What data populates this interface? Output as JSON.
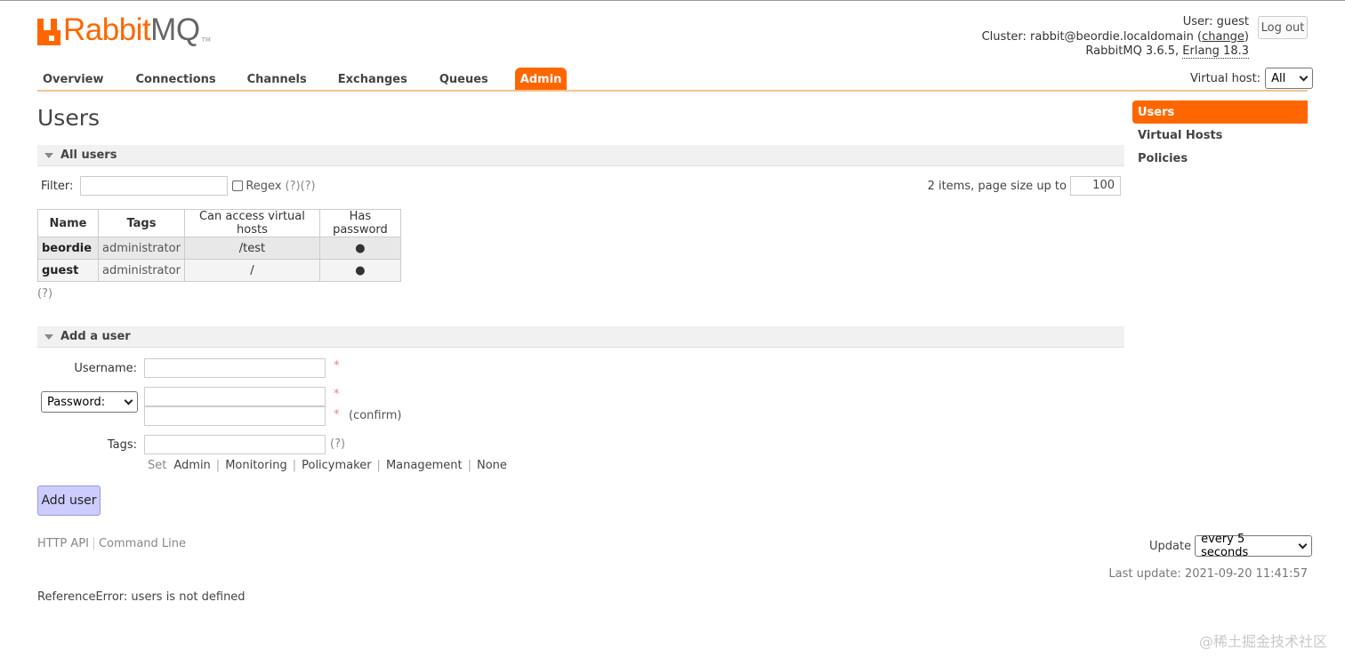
{
  "logo": {
    "brand_a": "Rabbit",
    "brand_b": "MQ",
    "tm": "TM"
  },
  "header": {
    "user_label": "User:",
    "user_value": "guest",
    "cluster_label": "Cluster:",
    "cluster_value": "rabbit@beordie.localdomain",
    "change_link": "change",
    "version": "RabbitMQ 3.6.5,",
    "erlang": "Erlang 18.3",
    "logout": "Log out"
  },
  "nav": {
    "tabs": [
      "Overview",
      "Connections",
      "Channels",
      "Exchanges",
      "Queues",
      "Admin"
    ],
    "active": "Admin",
    "vhost_label": "Virtual host:",
    "vhost_value": "All"
  },
  "page": {
    "title": "Users"
  },
  "sidebar": {
    "items": [
      "Users",
      "Virtual Hosts",
      "Policies"
    ]
  },
  "all_users": {
    "header": "All users",
    "filter_label": "Filter:",
    "regex_label": "Regex",
    "regex_help": "(?)(?)",
    "count_text": "2 items, page size up to",
    "page_size": "100",
    "columns": [
      "Name",
      "Tags",
      "Can access virtual hosts",
      "Has password"
    ],
    "rows": [
      {
        "name": "beordie",
        "tags": "administrator",
        "vhosts": "/test",
        "has_password": "●"
      },
      {
        "name": "guest",
        "tags": "administrator",
        "vhosts": "/",
        "has_password": "●"
      }
    ],
    "help": "(?)"
  },
  "add_user": {
    "header": "Add a user",
    "username_label": "Username:",
    "password_option": "Password:",
    "confirm_label": "(confirm)",
    "tags_label": "Tags:",
    "tags_help": "(?)",
    "required_mark": "*",
    "set_label": "Set",
    "tag_links": [
      "Admin",
      "Monitoring",
      "Policymaker",
      "Management",
      "None"
    ],
    "submit": "Add user"
  },
  "footer": {
    "links": [
      "HTTP API",
      "Command Line"
    ],
    "update_label": "Update",
    "update_value": "every 5 seconds",
    "last_update": "Last update: 2021-09-20 11:41:57",
    "error": "ReferenceError: users is not defined",
    "watermark": "@稀土掘金技术社区"
  },
  "colors": {
    "accent": "#ff6600",
    "button": "#ccccff"
  }
}
